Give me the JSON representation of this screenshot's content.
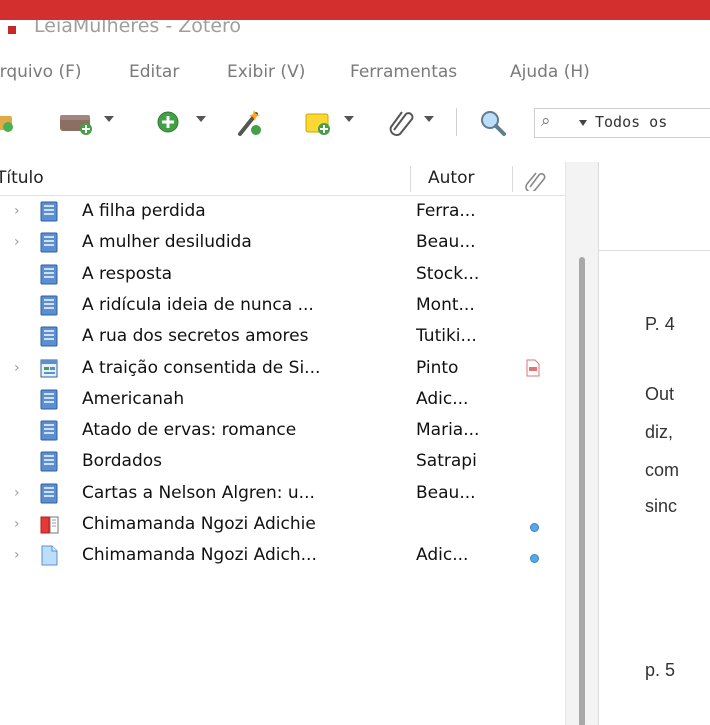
{
  "window": {
    "title": "LeiaMulheres - Zotero",
    "frame_color": "#d32f2f"
  },
  "menu": [
    "Arquivo (F)",
    "Editar",
    "Exibir (V)",
    "Ferramentas",
    "Ajuda (H)"
  ],
  "toolbar": {
    "icons": [
      "new-collection-icon",
      "new-library-icon",
      "new-item-icon",
      "add-by-identifier-icon",
      "new-note-icon",
      "attachment-icon",
      "locate-icon"
    ],
    "search_mode": "Todos os"
  },
  "list": {
    "columns": {
      "title": "Título",
      "author": "Autor"
    },
    "rows": [
      {
        "title": "A filha perdida",
        "author": "Ferra...",
        "expandable": true,
        "type": "book",
        "attachment": ""
      },
      {
        "title": "A mulher desiludida",
        "author": "Beau...",
        "expandable": true,
        "type": "book",
        "attachment": ""
      },
      {
        "title": "A resposta",
        "author": "Stock...",
        "expandable": false,
        "type": "book",
        "attachment": ""
      },
      {
        "title": "A ridícula ideia de nunca ...",
        "author": "Mont...",
        "expandable": false,
        "type": "book",
        "attachment": ""
      },
      {
        "title": "A rua dos secretos amores",
        "author": "Tutiki...",
        "expandable": false,
        "type": "book",
        "attachment": ""
      },
      {
        "title": "A traição consentida de Si...",
        "author": "Pinto",
        "expandable": true,
        "type": "webpage",
        "attachment": "pdf"
      },
      {
        "title": "Americanah",
        "author": "Adic...",
        "expandable": false,
        "type": "book",
        "attachment": ""
      },
      {
        "title": "Atado de ervas: romance",
        "author": "Maria...",
        "expandable": false,
        "type": "book",
        "attachment": ""
      },
      {
        "title": "Bordados",
        "author": "Satrapi",
        "expandable": false,
        "type": "book",
        "attachment": ""
      },
      {
        "title": "Cartas a Nelson Algren: u...",
        "author": "Beau...",
        "expandable": true,
        "type": "book",
        "attachment": ""
      },
      {
        "title": "Chimamanda Ngozi Adichie",
        "author": "",
        "expandable": true,
        "type": "book-section",
        "attachment": "dot"
      },
      {
        "title": "Chimamanda Ngozi Adich...",
        "author": "Adic...",
        "expandable": true,
        "type": "document",
        "attachment": "dot"
      }
    ]
  },
  "note_pane": {
    "lines": [
      "P. 4",
      "Out",
      "diz,",
      "com",
      "sinc",
      "p. 5"
    ]
  }
}
